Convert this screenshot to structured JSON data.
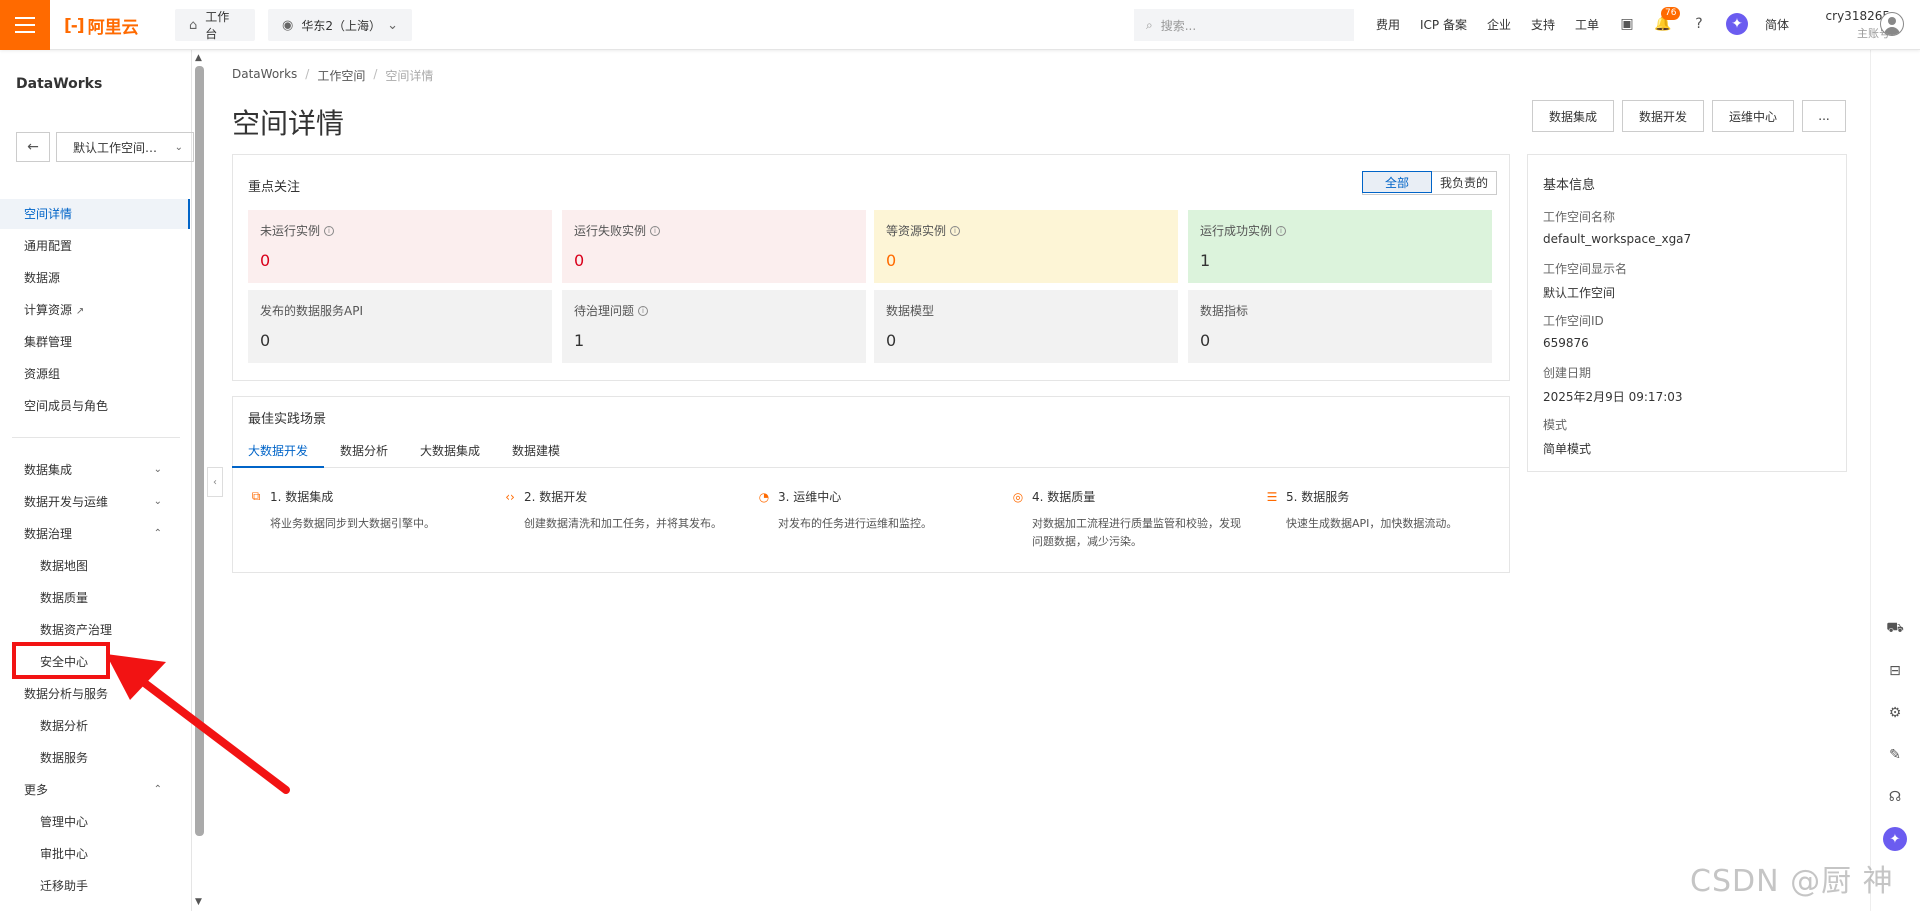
{
  "header": {
    "logo_text": "阿里云",
    "workbench": "工作台",
    "region": "华东2（上海）",
    "search_placeholder": "搜索...",
    "links": [
      "费用",
      "ICP 备案",
      "企业",
      "支持",
      "工单"
    ],
    "notification_count": "76",
    "language": "简体",
    "user_name": "cry318265",
    "user_role": "主账号"
  },
  "sidebar": {
    "title": "DataWorks",
    "workspace_select": "默认工作空间…",
    "items": [
      {
        "label": "空间详情",
        "active": true
      },
      {
        "label": "通用配置"
      },
      {
        "label": "数据源"
      },
      {
        "label": "计算资源"
      },
      {
        "label": "集群管理"
      },
      {
        "label": "资源组"
      },
      {
        "label": "空间成员与角色"
      }
    ],
    "groups": [
      {
        "label": "数据集成"
      },
      {
        "label": "数据开发与运维"
      },
      {
        "label": "数据治理"
      },
      {
        "label": "数据地图"
      },
      {
        "label": "数据质量"
      },
      {
        "label": "数据资产治理"
      },
      {
        "label": "安全中心"
      },
      {
        "label": "数据分析与服务"
      },
      {
        "label": "数据分析"
      },
      {
        "label": "数据服务"
      },
      {
        "label": "更多"
      },
      {
        "label": "管理中心"
      },
      {
        "label": "审批中心"
      },
      {
        "label": "迁移助手"
      }
    ]
  },
  "breadcrumb": [
    "DataWorks",
    "工作空间",
    "空间详情"
  ],
  "page_title": "空间详情",
  "header_buttons": [
    "数据集成",
    "数据开发",
    "运维中心",
    "..."
  ],
  "focus": {
    "title": "重点关注",
    "filters": [
      "全部",
      "我负责的"
    ],
    "stats": [
      {
        "label": "未运行实例",
        "value": "0",
        "color": "#d9001b",
        "bg": "#fbeeee"
      },
      {
        "label": "运行失败实例",
        "value": "0",
        "color": "#d9001b",
        "bg": "#fbeeee"
      },
      {
        "label": "等资源实例",
        "value": "0",
        "color": "#ff6a00",
        "bg": "#fdf5d6"
      },
      {
        "label": "运行成功实例",
        "value": "1",
        "color": "#333333",
        "bg": "#dcf3dc"
      },
      {
        "label": "发布的数据服务API",
        "value": "0",
        "color": "#333333",
        "bg": "#f2f2f2"
      },
      {
        "label": "待治理问题",
        "value": "1",
        "color": "#333333",
        "bg": "#f2f2f2"
      },
      {
        "label": "数据模型",
        "value": "0",
        "color": "#333333",
        "bg": "#f2f2f2"
      },
      {
        "label": "数据指标",
        "value": "0",
        "color": "#333333",
        "bg": "#f2f2f2"
      }
    ]
  },
  "practice": {
    "title": "最佳实践场景",
    "tabs": [
      "大数据开发",
      "数据分析",
      "大数据集成",
      "数据建模"
    ],
    "steps": [
      {
        "title": "1. 数据集成",
        "desc": "将业务数据同步到大数据引擎中。"
      },
      {
        "title": "2. 数据开发",
        "desc": "创建数据清洗和加工任务，并将其发布。"
      },
      {
        "title": "3. 运维中心",
        "desc": "对发布的任务进行运维和监控。"
      },
      {
        "title": "4. 数据质量",
        "desc": "对数据加工流程进行质量监管和校验，发现问题数据，减少污染。"
      },
      {
        "title": "5. 数据服务",
        "desc": "快速生成数据API，加快数据流动。"
      }
    ]
  },
  "basic_info": {
    "title": "基本信息",
    "fields": [
      {
        "label": "工作空间名称",
        "value": "default_workspace_xga7"
      },
      {
        "label": "工作空间显示名",
        "value": "默认工作空间"
      },
      {
        "label": "工作空间ID",
        "value": "659876"
      },
      {
        "label": "创建日期",
        "value": "2025年2月9日 09:17:03"
      },
      {
        "label": "模式",
        "value": "简单模式"
      }
    ]
  },
  "watermark": "CSDN @厨 神"
}
